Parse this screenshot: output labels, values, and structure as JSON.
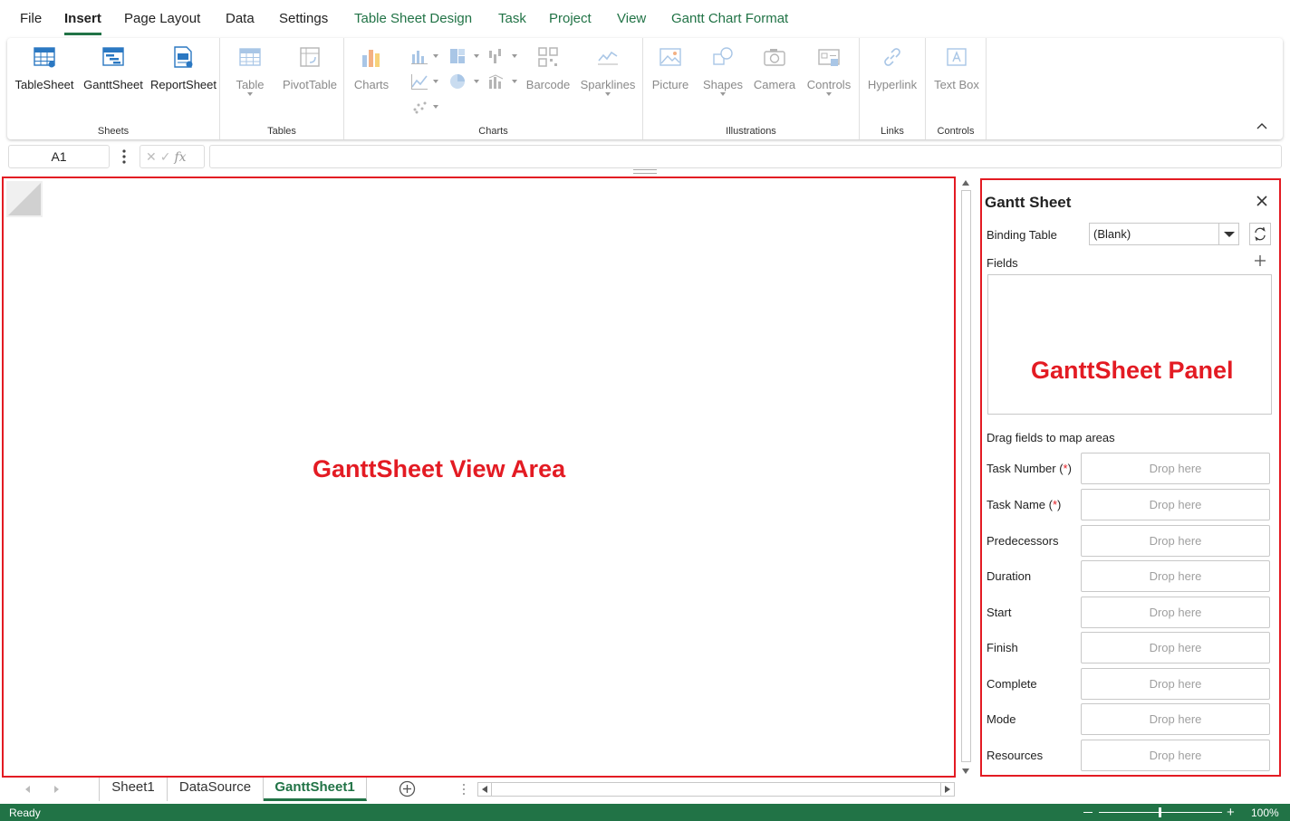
{
  "menu": {
    "tabs": [
      {
        "label": "File"
      },
      {
        "label": "Insert"
      },
      {
        "label": "Page Layout"
      },
      {
        "label": "Data"
      },
      {
        "label": "Settings"
      },
      {
        "label": "Table Sheet Design"
      },
      {
        "label": "Task"
      },
      {
        "label": "Project"
      },
      {
        "label": "View"
      },
      {
        "label": "Gantt Chart Format"
      }
    ],
    "active": "Insert"
  },
  "ribbon": {
    "groups": {
      "sheets": {
        "label": "Sheets",
        "buttons": [
          "TableSheet",
          "GanttSheet",
          "ReportSheet"
        ]
      },
      "tables": {
        "label": "Tables",
        "buttons": [
          "Table",
          "PivotTable"
        ]
      },
      "charts": {
        "label": "Charts",
        "buttons": [
          "Charts",
          "Barcode",
          "Sparklines"
        ]
      },
      "illustrations": {
        "label": "Illustrations",
        "buttons": [
          "Picture",
          "Shapes",
          "Camera",
          "Controls"
        ]
      },
      "links": {
        "label": "Links",
        "buttons": [
          "Hyperlink"
        ]
      },
      "controls": {
        "label": "Controls",
        "buttons": [
          "Text Box"
        ]
      }
    }
  },
  "formula_bar": {
    "name_box": "A1",
    "fx": "fx",
    "value": ""
  },
  "annotations": {
    "view_area": "GanttSheet View Area",
    "panel": "GanttSheet Panel"
  },
  "sheet_tabs": {
    "tabs": [
      "Sheet1",
      "DataSource",
      "GanttSheet1"
    ],
    "active": "GanttSheet1"
  },
  "status": {
    "text": "Ready",
    "zoom": "100%",
    "zoom_level": 0.5
  },
  "panel": {
    "title": "Gantt Sheet",
    "binding_table_label": "Binding Table",
    "binding_table_value": "(Blank)",
    "fields_label": "Fields",
    "map_label": "Drag fields to map areas",
    "drop_placeholder": "Drop here",
    "required_marker": "(*)",
    "mappings": [
      {
        "label": "Task Number",
        "required": true
      },
      {
        "label": "Task Name",
        "required": true
      },
      {
        "label": "Predecessors",
        "required": false
      },
      {
        "label": "Duration",
        "required": false
      },
      {
        "label": "Start",
        "required": false
      },
      {
        "label": "Finish",
        "required": false
      },
      {
        "label": "Complete",
        "required": false
      },
      {
        "label": "Mode",
        "required": false
      },
      {
        "label": "Resources",
        "required": false
      }
    ]
  },
  "colors": {
    "accent": "#217346",
    "annotation": "#e31b23"
  }
}
